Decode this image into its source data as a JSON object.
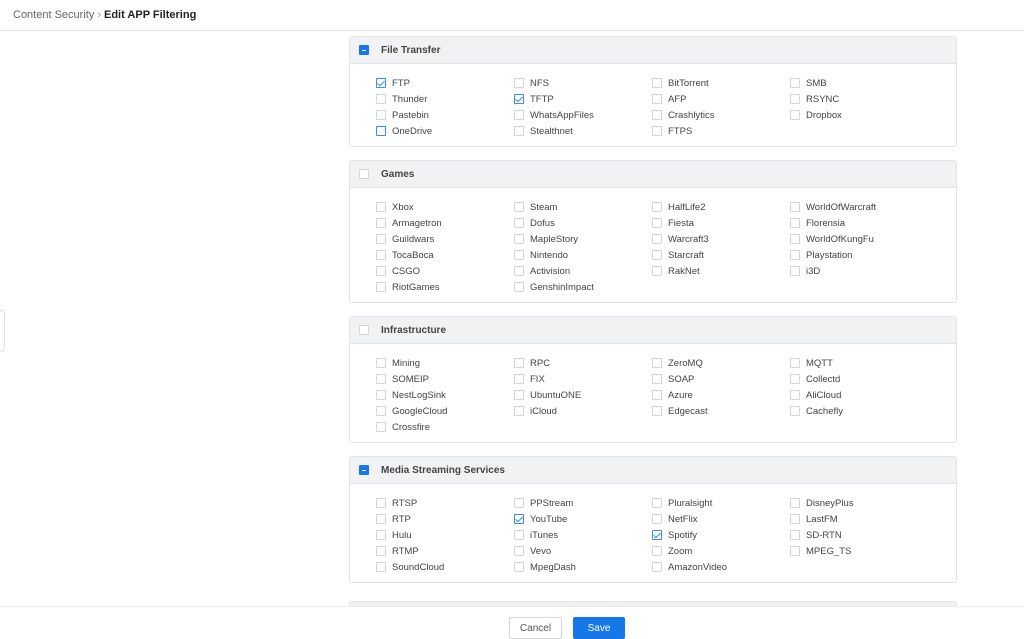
{
  "breadcrumb": {
    "parent": "Content Security",
    "separator": "›",
    "current": "Edit APP Filtering"
  },
  "groups": [
    {
      "title": "File Transfer",
      "state": "partial",
      "items": [
        {
          "label": "FTP",
          "checked": true
        },
        {
          "label": "NFS",
          "checked": false
        },
        {
          "label": "BitTorrent",
          "checked": false
        },
        {
          "label": "SMB",
          "checked": false
        },
        {
          "label": "Thunder",
          "checked": false
        },
        {
          "label": "TFTP",
          "checked": true
        },
        {
          "label": "AFP",
          "checked": false
        },
        {
          "label": "RSYNC",
          "checked": false
        },
        {
          "label": "Pastebin",
          "checked": false
        },
        {
          "label": "WhatsAppFiles",
          "checked": false
        },
        {
          "label": "Crashlytics",
          "checked": false
        },
        {
          "label": "Dropbox",
          "checked": false
        },
        {
          "label": "OneDrive",
          "checked": false,
          "hover": true
        },
        {
          "label": "Stealthnet",
          "checked": false
        },
        {
          "label": "FTPS",
          "checked": false
        }
      ]
    },
    {
      "title": "Games",
      "state": "none",
      "items": [
        {
          "label": "Xbox",
          "checked": false
        },
        {
          "label": "Steam",
          "checked": false
        },
        {
          "label": "HalfLife2",
          "checked": false
        },
        {
          "label": "WorldOfWarcraft",
          "checked": false
        },
        {
          "label": "Armagetron",
          "checked": false
        },
        {
          "label": "Dofus",
          "checked": false
        },
        {
          "label": "Fiesta",
          "checked": false
        },
        {
          "label": "Florensia",
          "checked": false
        },
        {
          "label": "Guildwars",
          "checked": false
        },
        {
          "label": "MapleStory",
          "checked": false
        },
        {
          "label": "Warcraft3",
          "checked": false
        },
        {
          "label": "WorldOfKungFu",
          "checked": false
        },
        {
          "label": "TocaBoca",
          "checked": false
        },
        {
          "label": "Nintendo",
          "checked": false
        },
        {
          "label": "Starcraft",
          "checked": false
        },
        {
          "label": "Playstation",
          "checked": false
        },
        {
          "label": "CSGO",
          "checked": false
        },
        {
          "label": "Activision",
          "checked": false
        },
        {
          "label": "RakNet",
          "checked": false
        },
        {
          "label": "i3D",
          "checked": false
        },
        {
          "label": "RiotGames",
          "checked": false
        },
        {
          "label": "GenshinImpact",
          "checked": false
        }
      ]
    },
    {
      "title": "Infrastructure",
      "state": "none",
      "items": [
        {
          "label": "Mining",
          "checked": false
        },
        {
          "label": "RPC",
          "checked": false
        },
        {
          "label": "ZeroMQ",
          "checked": false
        },
        {
          "label": "MQTT",
          "checked": false
        },
        {
          "label": "SOMEIP",
          "checked": false
        },
        {
          "label": "FIX",
          "checked": false
        },
        {
          "label": "SOAP",
          "checked": false
        },
        {
          "label": "Collectd",
          "checked": false
        },
        {
          "label": "NestLogSink",
          "checked": false
        },
        {
          "label": "UbuntuONE",
          "checked": false
        },
        {
          "label": "Azure",
          "checked": false
        },
        {
          "label": "AliCloud",
          "checked": false
        },
        {
          "label": "GoogleCloud",
          "checked": false
        },
        {
          "label": "iCloud",
          "checked": false
        },
        {
          "label": "Edgecast",
          "checked": false
        },
        {
          "label": "Cachefly",
          "checked": false
        },
        {
          "label": "Crossfire",
          "checked": false
        }
      ]
    },
    {
      "title": "Media Streaming Services",
      "state": "partial",
      "items": [
        {
          "label": "RTSP",
          "checked": false
        },
        {
          "label": "PPStream",
          "checked": false
        },
        {
          "label": "Pluralsight",
          "checked": false
        },
        {
          "label": "DisneyPlus",
          "checked": false
        },
        {
          "label": "RTP",
          "checked": false
        },
        {
          "label": "YouTube",
          "checked": true
        },
        {
          "label": "NetFlix",
          "checked": false
        },
        {
          "label": "LastFM",
          "checked": false
        },
        {
          "label": "Hulu",
          "checked": false
        },
        {
          "label": "iTunes",
          "checked": false
        },
        {
          "label": "Spotify",
          "checked": true
        },
        {
          "label": "SD-RTN",
          "checked": false
        },
        {
          "label": "RTMP",
          "checked": false
        },
        {
          "label": "Vevo",
          "checked": false
        },
        {
          "label": "Zoom",
          "checked": false
        },
        {
          "label": "MPEG_TS",
          "checked": false
        },
        {
          "label": "SoundCloud",
          "checked": false
        },
        {
          "label": "MpegDash",
          "checked": false
        },
        {
          "label": "AmazonVideo",
          "checked": false
        }
      ]
    }
  ],
  "footer": {
    "cancel_label": "Cancel",
    "save_label": "Save"
  },
  "colors": {
    "accent": "#1677e8",
    "header_bg": "#f1f2f4",
    "border": "#e1e4e8"
  }
}
